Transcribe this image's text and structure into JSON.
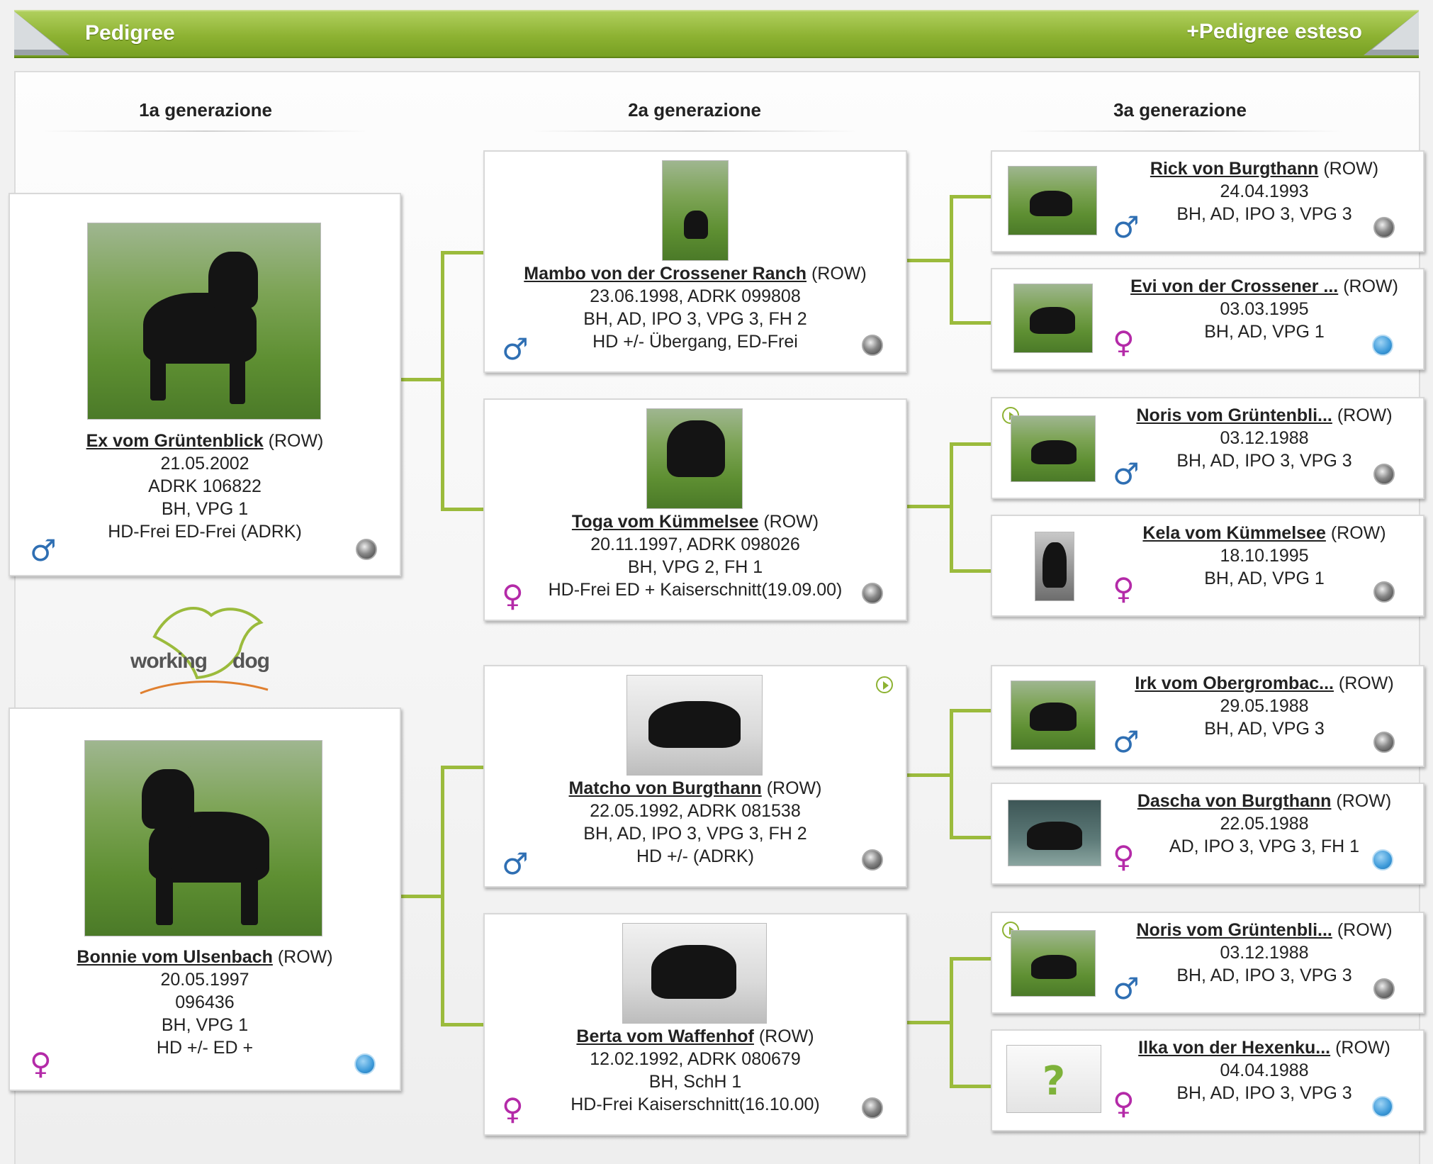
{
  "header": {
    "title": "Pedigree",
    "extended_link": "+Pedigree esteso"
  },
  "generations": [
    "1a generazione",
    "2a generazione",
    "3a generazione"
  ],
  "logo": {
    "word1": "working",
    "word2": "dog"
  },
  "colors": {
    "accent": "#8db232",
    "male": "#2f6fb3",
    "female": "#b42aa8",
    "link": "#222222"
  },
  "dogs": {
    "g1a": {
      "name": "Ex vom Grüntenblick",
      "breed": "(ROW)",
      "lines": [
        "21.05.2002",
        "ADRK 106822",
        "BH, VPG 1",
        "HD-Frei ED-Frei (ADRK)"
      ],
      "sex": "♂",
      "badge": "club"
    },
    "g1b": {
      "name": "Bonnie vom Ulsenbach",
      "breed": "(ROW)",
      "lines": [
        "20.05.1997",
        "096436",
        "BH, VPG 1",
        "HD +/- ED +"
      ],
      "sex": "♀",
      "badge": "fci"
    },
    "g2a": {
      "name": "Mambo von der Crossener Ranch",
      "breed": "(ROW)",
      "lines": [
        "23.06.1998, ADRK 099808",
        "BH, AD, IPO 3, VPG 3, FH 2",
        "HD +/- Übergang, ED-Frei"
      ],
      "sex": "♂",
      "badge": "club"
    },
    "g2b": {
      "name": "Toga vom Kümmelsee",
      "breed": "(ROW)",
      "lines": [
        "20.11.1997, ADRK 098026",
        "BH, VPG 2, FH 1",
        "HD-Frei ED + Kaiserschnitt(19.09.00)"
      ],
      "sex": "♀",
      "badge": "club"
    },
    "g2c": {
      "name": "Matcho von Burgthann",
      "breed": "(ROW)",
      "lines": [
        "22.05.1992, ADRK 081538",
        "BH, AD, IPO 3, VPG 3, FH 2",
        "HD +/- (ADRK)"
      ],
      "sex": "♂",
      "badge": "club"
    },
    "g2d": {
      "name": "Berta vom Waffenhof",
      "breed": "(ROW)",
      "lines": [
        "12.02.1992, ADRK 080679",
        "BH, SchH 1",
        "HD-Frei Kaiserschnitt(16.10.00)"
      ],
      "sex": "♀",
      "badge": "club"
    },
    "g3a": {
      "name": "Rick von Burgthann",
      "breed": "(ROW)",
      "lines": [
        "24.04.1993",
        "BH, AD, IPO 3, VPG 3"
      ],
      "sex": "♂",
      "badge": "club"
    },
    "g3b": {
      "name": "Evi von der Crossener ...",
      "breed": "(ROW)",
      "lines": [
        "03.03.1995",
        "BH, AD, VPG 1"
      ],
      "sex": "♀",
      "badge": "fci"
    },
    "g3c": {
      "name": "Noris vom Grüntenbli...",
      "breed": "(ROW)",
      "lines": [
        "03.12.1988",
        "BH, AD, IPO 3, VPG 3"
      ],
      "sex": "♂",
      "badge": "club"
    },
    "g3d": {
      "name": "Kela vom Kümmelsee",
      "breed": "(ROW)",
      "lines": [
        "18.10.1995",
        "BH, AD, VPG 1"
      ],
      "sex": "♀",
      "badge": "club"
    },
    "g3e": {
      "name": "Irk vom Obergrombac...",
      "breed": "(ROW)",
      "lines": [
        "29.05.1988",
        "BH, AD, VPG 3"
      ],
      "sex": "♂",
      "badge": "club"
    },
    "g3f": {
      "name": "Dascha von Burgthann",
      "breed": "(ROW)",
      "lines": [
        "22.05.1988",
        "AD, IPO 3, VPG 3, FH 1"
      ],
      "sex": "♀",
      "badge": "fci"
    },
    "g3g": {
      "name": "Noris vom Grüntenbli...",
      "breed": "(ROW)",
      "lines": [
        "03.12.1988",
        "BH, AD, IPO 3, VPG 3"
      ],
      "sex": "♂",
      "badge": "club"
    },
    "g3h": {
      "name": "Ilka von der Hexenku...",
      "breed": "(ROW)",
      "lines": [
        "04.04.1988",
        "BH, AD, IPO 3, VPG 3"
      ],
      "sex": "♀",
      "badge": "fci"
    }
  }
}
